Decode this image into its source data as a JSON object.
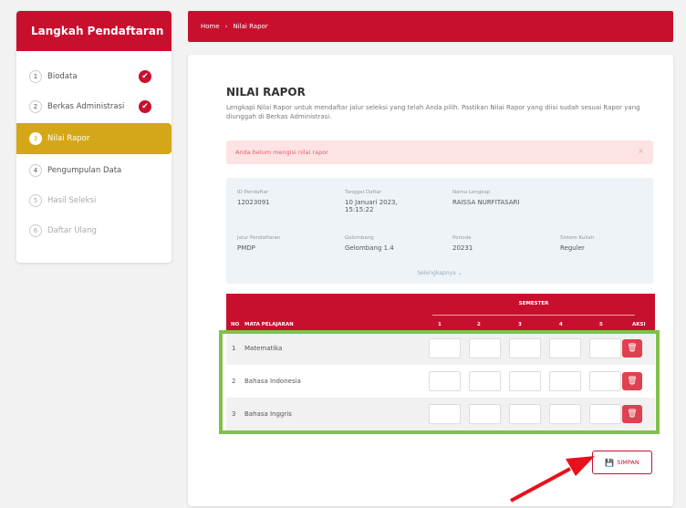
{
  "sidebar": {
    "title": "Langkah Pendaftaran",
    "steps": [
      {
        "num": "1",
        "label": "Biodata",
        "done": true
      },
      {
        "num": "2",
        "label": "Berkas Administrasi",
        "done": true
      },
      {
        "num": "3",
        "label": "Nilai Rapor",
        "active": true
      },
      {
        "num": "4",
        "label": "Pengumpulan Data"
      },
      {
        "num": "5",
        "label": "Hasil Seleksi"
      },
      {
        "num": "6",
        "label": "Daftar Ulang"
      }
    ],
    "check_glyph": "✔"
  },
  "breadcrumb": {
    "home": "Home",
    "separator": "›",
    "current": "Nilai Rapor"
  },
  "page": {
    "title": "NILAI RAPOR",
    "description": "Lengkapi Nilai Rapor untuk mendaftar jalur seleksi yang telah Anda pilih. Pastikan Nilai Rapor yang diisi sudah sesuai Rapor yang diunggah di Berkas Administrasi."
  },
  "alert": {
    "text": "Anda belum mengisi nilai rapor",
    "close": "×"
  },
  "info": {
    "id_label": "ID Pendaftar",
    "id_value": "12023091",
    "date_label": "Tanggal Daftar",
    "date_value": "10 Januari 2023, 15:15:22",
    "name_label": "Nama Lengkap",
    "name_value": "RAISSA NURFITASARI",
    "path_label": "Jalur Pendaftaran",
    "path_value": "PMDP",
    "wave_label": "Gelombang",
    "wave_value": "Gelombang 1.4",
    "period_label": "Periode",
    "period_value": "20231",
    "lecture_label": "Sistem Kuliah",
    "lecture_value": "Reguler",
    "more": "Selengkapnya ⌄"
  },
  "table": {
    "col_no": "NO",
    "col_subject": "MATA PELAJARAN",
    "col_semester": "SEMESTER",
    "semesters": [
      "1",
      "2",
      "3",
      "4",
      "5"
    ],
    "col_action": "AKSI",
    "rows": [
      {
        "no": "1",
        "subject": "Matematika"
      },
      {
        "no": "2",
        "subject": "Bahasa Indonesia"
      },
      {
        "no": "3",
        "subject": "Bahasa Inggris"
      }
    ],
    "delete_glyph": "🗑"
  },
  "save_button": {
    "icon": "💾",
    "label": "SIMPAN"
  },
  "colors": {
    "brand": "#c8102e",
    "active": "#d4a719",
    "highlight": "#7fc14b",
    "arrow": "#e8101a"
  }
}
